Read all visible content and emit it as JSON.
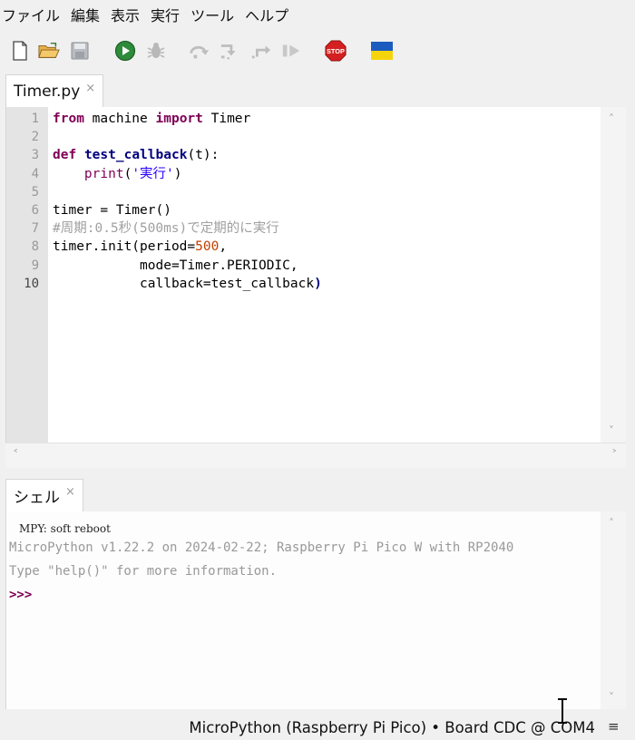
{
  "menubar": {
    "items": [
      "ファイル",
      "編集",
      "表示",
      "実行",
      "ツール",
      "ヘルプ"
    ]
  },
  "toolbar": {
    "buttons": [
      {
        "icon": "new-file-icon"
      },
      {
        "icon": "open-folder-icon"
      },
      {
        "icon": "save-icon"
      },
      {
        "icon": "run-icon"
      },
      {
        "icon": "debug-icon"
      },
      {
        "icon": "step-over-icon"
      },
      {
        "icon": "step-into-icon"
      },
      {
        "icon": "step-out-icon"
      },
      {
        "icon": "resume-icon"
      },
      {
        "icon": "stop-icon",
        "label": "STOP"
      },
      {
        "icon": "ukraine-flag-icon"
      }
    ],
    "colors": {
      "run": "#2e8b3a",
      "stop": "#d42020",
      "flag_blue": "#1c5bbf",
      "flag_yellow": "#f6d40d"
    }
  },
  "editor": {
    "tab": {
      "label": "Timer.py",
      "close": "×"
    },
    "line_numbers": [
      "1",
      "2",
      "3",
      "4",
      "5",
      "6",
      "7",
      "8",
      "9",
      "10"
    ],
    "lines": [
      [
        {
          "t": "from",
          "c": "kw"
        },
        {
          "t": " machine ",
          "c": "op"
        },
        {
          "t": "import",
          "c": "kw"
        },
        {
          "t": " Timer",
          "c": "op"
        }
      ],
      [],
      [
        {
          "t": "def",
          "c": "kw"
        },
        {
          "t": " ",
          "c": "op"
        },
        {
          "t": "test_callback",
          "c": "fn"
        },
        {
          "t": "(t):",
          "c": "op"
        }
      ],
      [
        {
          "t": "    ",
          "c": "op"
        },
        {
          "t": "print",
          "c": "bi"
        },
        {
          "t": "(",
          "c": "op"
        },
        {
          "t": "'実行'",
          "c": "str"
        },
        {
          "t": ")",
          "c": "op"
        }
      ],
      [],
      [
        {
          "t": "timer = Timer()",
          "c": "op"
        }
      ],
      [
        {
          "t": "#周期:0.5秒(500ms)で定期的に実行",
          "c": "cm"
        }
      ],
      [
        {
          "t": "timer.init(period=",
          "c": "op"
        },
        {
          "t": "500",
          "c": "num"
        },
        {
          "t": ",",
          "c": "op"
        }
      ],
      [
        {
          "t": "           mode=Timer.PERIODIC,",
          "c": "op"
        }
      ],
      [
        {
          "t": "           callback=test_callback",
          "c": "op"
        },
        {
          "t": ")",
          "c": "fn"
        }
      ]
    ]
  },
  "shell": {
    "tab": {
      "label": "シェル",
      "close": "×"
    },
    "reboot_line": "MPY: soft reboot",
    "banner_line": "MicroPython v1.22.2 on 2024-02-22; Raspberry Pi Pico W with RP2040",
    "help_line": "Type \"help()\" for more information.",
    "prompt": ">>>"
  },
  "statusbar": {
    "text": "MicroPython (Raspberry Pi Pico)  •  Board CDC @ COM4",
    "menu_glyph": "≡"
  },
  "scroll": {
    "up": "˄",
    "down": "˅",
    "left": "˂",
    "right": "˃"
  }
}
